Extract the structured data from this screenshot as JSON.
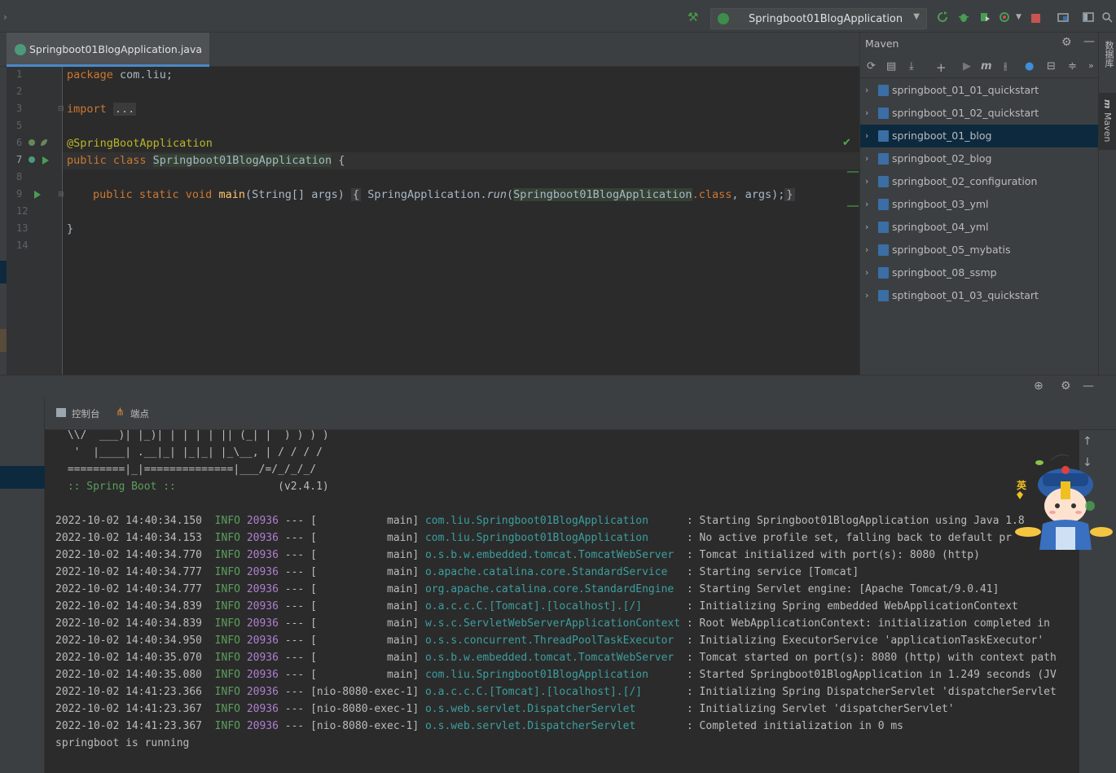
{
  "toolbar": {
    "run_config": "Springboot01BlogApplication"
  },
  "editor": {
    "tab_label": "Springboot01BlogApplication.java",
    "line_numbers": [
      "1",
      "2",
      "3",
      "5",
      "6",
      "7",
      "8",
      "9",
      "12",
      "13",
      "14"
    ],
    "code": {
      "l1_kw": "package",
      "l1_rest": " com.liu;",
      "l3_kw": "import",
      "l3_fold": "...",
      "l6_at": "@",
      "l6_ann": "SpringBootApplication",
      "l7_kw": "public class ",
      "l7_cls": "Springboot01BlogApplication",
      "l7_rest": " {",
      "l9_kw": "public static void ",
      "l9_fn": "main",
      "l9_params": "(String[] args) ",
      "l9_open": "{",
      "l9_body1": " SpringApplication.",
      "l9_run": "run",
      "l9_paren": "(",
      "l9_cls": "Springboot01BlogApplication",
      "l9_dotclass": ".class",
      "l9_args": ", args);",
      "l9_close": "}",
      "l13": "}"
    }
  },
  "maven": {
    "title": "Maven",
    "projects": [
      {
        "name": "springboot_01_01_quickstart",
        "selected": false
      },
      {
        "name": "springboot_01_02_quickstart",
        "selected": false
      },
      {
        "name": "springboot_01_blog",
        "selected": true
      },
      {
        "name": "springboot_02_blog",
        "selected": false
      },
      {
        "name": "springboot_02_configuration",
        "selected": false
      },
      {
        "name": "springboot_03_yml",
        "selected": false
      },
      {
        "name": "springboot_04_yml",
        "selected": false
      },
      {
        "name": "springboot_05_mybatis",
        "selected": false
      },
      {
        "name": "springboot_08_ssmp",
        "selected": false
      },
      {
        "name": "sptingboot_01_03_quickstart",
        "selected": false
      }
    ]
  },
  "right_strip": {
    "database_label": "数据库",
    "maven_label": "Maven"
  },
  "bottom": {
    "tab_console": "控制台",
    "tab_endpoints": "端点"
  },
  "console": {
    "banner": [
      " \\\\/  ___)| |_)| | | | | || (_| |  ) ) ) )",
      "  '  |____| .__|_| |_|_| |_\\__, | / / / /",
      " =========|_|==============|___/=/_/_/_/"
    ],
    "spring_boot_label": " :: Spring Boot :: ",
    "spring_boot_version": "               (v2.4.1)",
    "logs": [
      {
        "ts": "2022-10-02 14:40:34.150",
        "level": "INFO",
        "pid": "20936",
        "thread": "[           main]",
        "logger": "com.liu.Springboot01BlogApplication     ",
        "msg": ": Starting Springboot01BlogApplication using Java 1.8"
      },
      {
        "ts": "2022-10-02 14:40:34.153",
        "level": "INFO",
        "pid": "20936",
        "thread": "[           main]",
        "logger": "com.liu.Springboot01BlogApplication     ",
        "msg": ": No active profile set, falling back to default pr"
      },
      {
        "ts": "2022-10-02 14:40:34.770",
        "level": "INFO",
        "pid": "20936",
        "thread": "[           main]",
        "logger": "o.s.b.w.embedded.tomcat.TomcatWebServer ",
        "msg": ": Tomcat initialized with port(s): 8080 (http)"
      },
      {
        "ts": "2022-10-02 14:40:34.777",
        "level": "INFO",
        "pid": "20936",
        "thread": "[           main]",
        "logger": "o.apache.catalina.core.StandardService  ",
        "msg": ": Starting service [Tomcat]"
      },
      {
        "ts": "2022-10-02 14:40:34.777",
        "level": "INFO",
        "pid": "20936",
        "thread": "[           main]",
        "logger": "org.apache.catalina.core.StandardEngine ",
        "msg": ": Starting Servlet engine: [Apache Tomcat/9.0.41]"
      },
      {
        "ts": "2022-10-02 14:40:34.839",
        "level": "INFO",
        "pid": "20936",
        "thread": "[           main]",
        "logger": "o.a.c.c.C.[Tomcat].[localhost].[/]      ",
        "msg": ": Initializing Spring embedded WebApplicationContext"
      },
      {
        "ts": "2022-10-02 14:40:34.839",
        "level": "INFO",
        "pid": "20936",
        "thread": "[           main]",
        "logger": "w.s.c.ServletWebServerApplicationContext",
        "msg": ": Root WebApplicationContext: initialization completed in"
      },
      {
        "ts": "2022-10-02 14:40:34.950",
        "level": "INFO",
        "pid": "20936",
        "thread": "[           main]",
        "logger": "o.s.s.concurrent.ThreadPoolTaskExecutor ",
        "msg": ": Initializing ExecutorService 'applicationTaskExecutor'"
      },
      {
        "ts": "2022-10-02 14:40:35.070",
        "level": "INFO",
        "pid": "20936",
        "thread": "[           main]",
        "logger": "o.s.b.w.embedded.tomcat.TomcatWebServer ",
        "msg": ": Tomcat started on port(s): 8080 (http) with context path"
      },
      {
        "ts": "2022-10-02 14:40:35.080",
        "level": "INFO",
        "pid": "20936",
        "thread": "[           main]",
        "logger": "com.liu.Springboot01BlogApplication     ",
        "msg": ": Started Springboot01BlogApplication in 1.249 seconds (JV"
      },
      {
        "ts": "2022-10-02 14:41:23.366",
        "level": "INFO",
        "pid": "20936",
        "thread": "[nio-8080-exec-1]",
        "logger": "o.a.c.c.C.[Tomcat].[localhost].[/]      ",
        "msg": ": Initializing Spring DispatcherServlet 'dispatcherServlet"
      },
      {
        "ts": "2022-10-02 14:41:23.367",
        "level": "INFO",
        "pid": "20936",
        "thread": "[nio-8080-exec-1]",
        "logger": "o.s.web.servlet.DispatcherServlet       ",
        "msg": ": Initializing Servlet 'dispatcherServlet'"
      },
      {
        "ts": "2022-10-02 14:41:23.367",
        "level": "INFO",
        "pid": "20936",
        "thread": "[nio-8080-exec-1]",
        "logger": "o.s.web.servlet.DispatcherServlet       ",
        "msg": ": Completed initialization in 0 ms"
      }
    ],
    "last_line": "springboot is running"
  },
  "mascot": {
    "ying_char": "英"
  },
  "colors": {
    "accent": "#4a88c7",
    "run_green": "#499c54",
    "selection": "#0d293e"
  }
}
